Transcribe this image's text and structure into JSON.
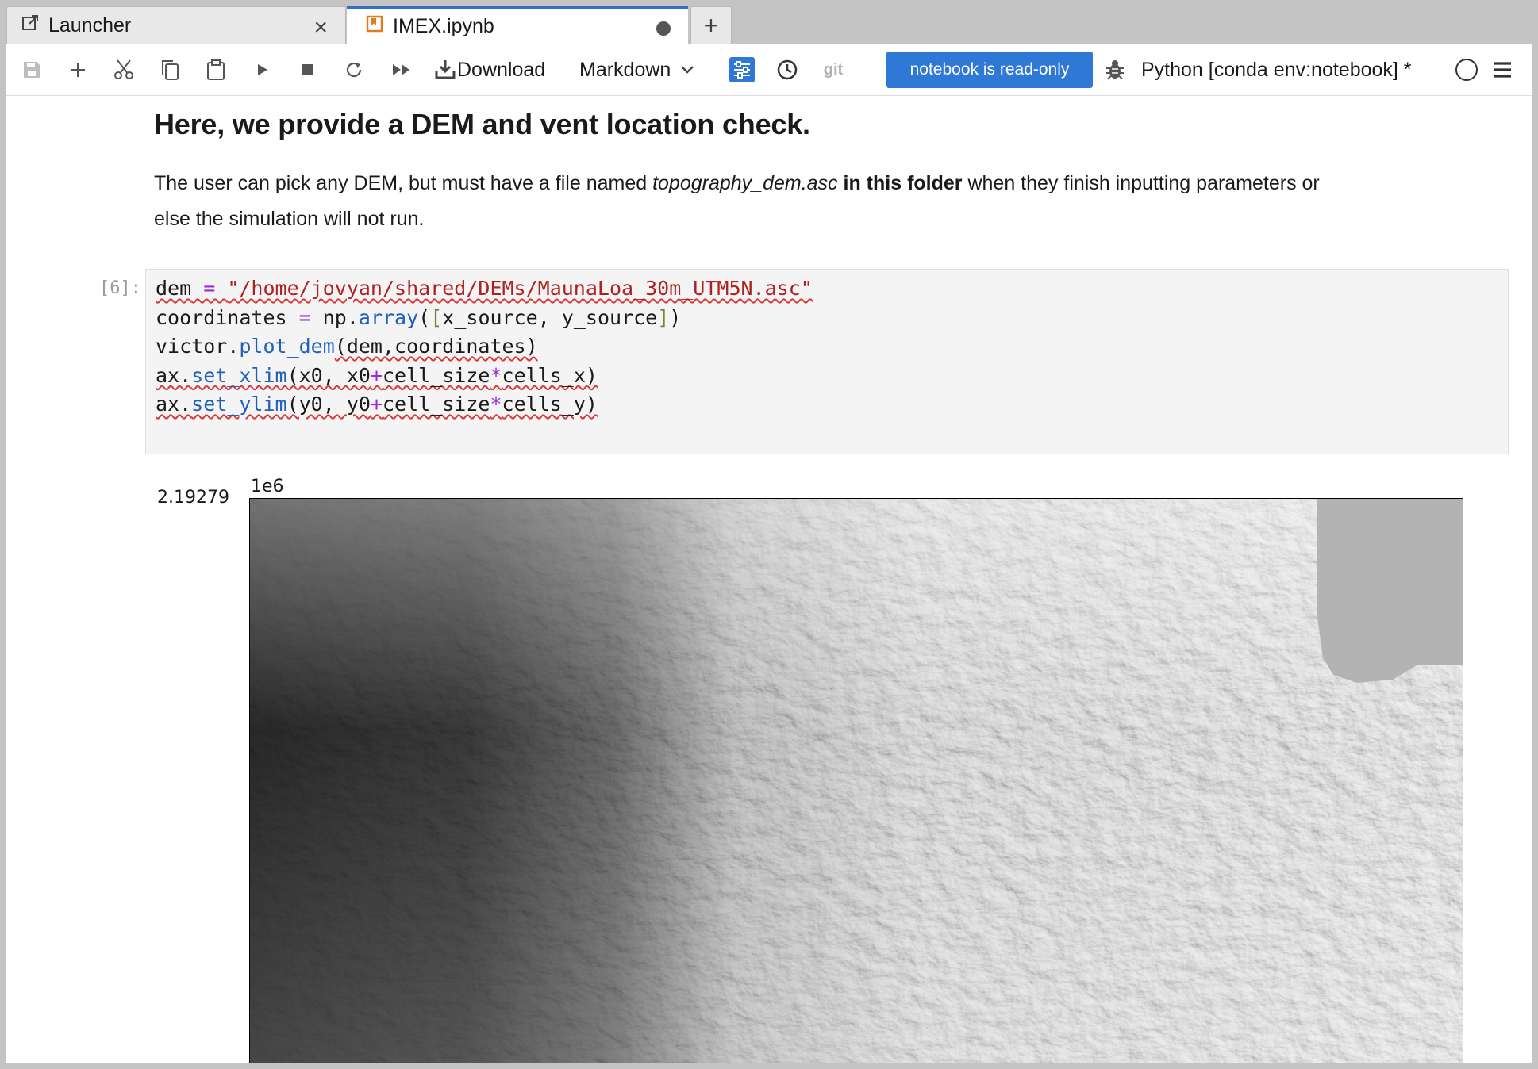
{
  "tabs": [
    {
      "label": "Launcher",
      "icon": "external-link-icon",
      "close": "×"
    },
    {
      "label": "IMEX.ipynb",
      "icon": "notebook-bookmark-icon",
      "accent": "#e07b24",
      "dirty": true
    }
  ],
  "toolbar": {
    "download_label": "Download",
    "cell_type": "Markdown",
    "git_label": "git",
    "readonly_label": "notebook is read-only",
    "kernel": "Python [conda env:notebook] *"
  },
  "notebook": {
    "heading": "Here, we provide a DEM and vent location check.",
    "para_1": "The user can pick any DEM, but must have a file named ",
    "para_italic": "topography_dem.asc",
    "para_bold": " in this folder",
    "para_2": " when they finish inputting parameters or else the simulation will not run.",
    "cell_prompt": "[6]:",
    "code": {
      "l1_var": "dem",
      "l1_op": " = ",
      "l1_str": "\"/home/jovyan/shared/DEMs/MaunaLoa_30m_UTM5N.asc\"",
      "l2_a": "coordinates ",
      "l2_op": "=",
      "l2_b": " np.",
      "l2_fn": "array",
      "l2_c": "(",
      "l2_br1": "[",
      "l2_d": "x_source, y_source",
      "l2_br2": "]",
      "l2_e": ")",
      "l3_a": "victor.",
      "l3_fn": "plot_dem",
      "l3_b": "(dem,coordinates)",
      "l4_a": "ax.",
      "l4_fn": "set_xlim",
      "l4_b": "(x0, x0",
      "l4_op1": "+",
      "l4_c": "cell_size",
      "l4_op2": "*",
      "l4_d": "cells_x)",
      "l5_a": "ax.",
      "l5_fn": "set_ylim",
      "l5_b": "(y0, y0",
      "l5_op1": "+",
      "l5_c": "cell_size",
      "l5_op2": "*",
      "l5_d": "cells_y)"
    }
  },
  "plot": {
    "offset_label": "1e6",
    "ytick_label": "2.19279",
    "vent_color": "#e02020",
    "dark_color": "#2a2a2a",
    "light_color": "#f2f2f2",
    "ocean_color": "#b3b3b3"
  }
}
